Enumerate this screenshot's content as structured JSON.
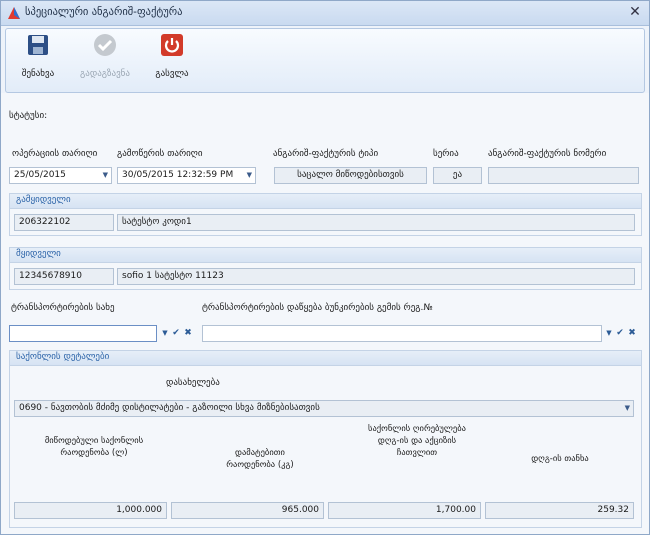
{
  "window": {
    "title": "სპეციალური ანგარიშ-ფაქტურა"
  },
  "toolbar": {
    "save_label": "შენახვა",
    "transfer_label": "გადაგზავნა",
    "exit_label": "გასვლა"
  },
  "status": {
    "label": "სტატუსი:"
  },
  "header_fields": {
    "operation_date_label": "ოპერაციის თარიღი",
    "operation_date_value": "25/05/2015",
    "issue_date_label": "გამოწერის თარიღი",
    "issue_date_value": "30/05/2015 12:32:59 PM",
    "invoice_type_label": "ანგარიშ-ფაქტურის ტიპი",
    "invoice_type_value": "საცალო მიწოდებისთვის",
    "series_label": "სერია",
    "series_value": "ეა",
    "invoice_number_label": "ანგარიშ-ფაქტურის ნომერი",
    "invoice_number_value": ""
  },
  "seller": {
    "title": "გამყიდველი",
    "code": "206322102",
    "name": "სატესტო კოდი1"
  },
  "buyer": {
    "title": "მყიდველი",
    "code": "12345678910",
    "name": "sofio  1 სატესტო 11123"
  },
  "transport": {
    "type_label": "ტრანსპორტირების სახე",
    "type_value": "",
    "plate_label": "ტრანსპორტირების დაწყება ბუნკირების გემის რეგ.№",
    "plate_value": ""
  },
  "goods": {
    "title": "საქონლის დეტალები",
    "name_label": "დასახელება",
    "name_value": "0690 - ნავთობის მძიმე დისტილატები - გაზოილი სხვა მიზნებისათვის",
    "columns": [
      {
        "header": "მიწოდებული საქონლის რაოდენობა (ლ)",
        "value": "1,000.000"
      },
      {
        "header": "დამატებითი რაოდენობა (კგ)",
        "value": "965.000"
      },
      {
        "header": "საქონლის ღირებულება დღგ-ის და აქციზის ჩათვლით",
        "value": "1,700.00"
      },
      {
        "header": "დღგ-ის თანხა",
        "value": "259.32"
      }
    ]
  },
  "colors": {
    "accent": "#2b63a8",
    "save_icon": "#2d4f86",
    "exit_icon": "#d23a2a"
  }
}
